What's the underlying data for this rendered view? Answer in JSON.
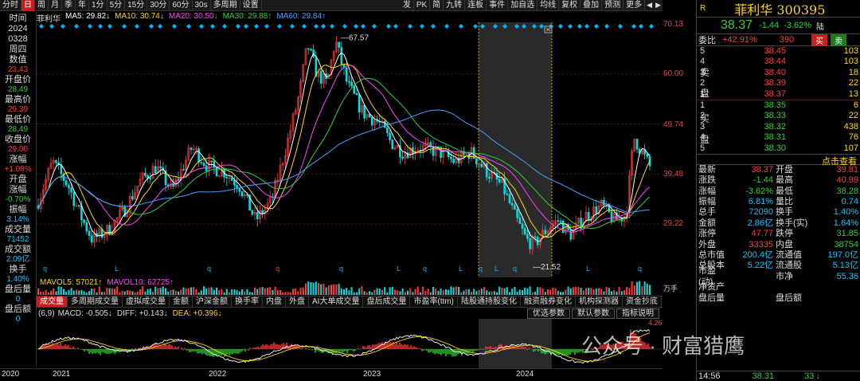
{
  "toolbar": {
    "left_items": [
      "分时",
      "日",
      "周",
      "月",
      "季",
      "年",
      "1分",
      "5分",
      "15分",
      "30分",
      "60分",
      "30s",
      "多周期",
      "设置"
    ],
    "active_index": 1,
    "right_items": [
      "发",
      "PK",
      "简",
      "九转",
      "连板",
      "事件",
      "加自选",
      "均线",
      "复权",
      "叠加",
      "预测",
      "更多"
    ]
  },
  "ma": {
    "name": "菲利华",
    "ma5": "MA5: 29.82↓",
    "ma10": "MA10: 30.74↓",
    "ma20": "MA20: 30.50↓",
    "ma30": "MA30: 29.88↑",
    "ma60": "MA60: 29.84↑",
    "colors": {
      "name": "#ddd",
      "ma5": "#ffffff",
      "ma10": "#ffd700",
      "ma20": "#ff40ff",
      "ma30": "#2fd02f",
      "ma60": "#4a9eff"
    }
  },
  "left_panel": [
    {
      "label": "时间",
      "value": "",
      "cls": ""
    },
    {
      "label": "2024",
      "value": "",
      "cls": ""
    },
    {
      "label": "0328",
      "value": "",
      "cls": ""
    },
    {
      "label": "周四",
      "value": "",
      "cls": ""
    },
    {
      "label": "数值",
      "value": "23.43",
      "cls": "red"
    },
    {
      "label": "开盘价",
      "value": "28.49",
      "cls": "green"
    },
    {
      "label": "最高价",
      "value": "29.39",
      "cls": "red"
    },
    {
      "label": "最低价",
      "value": "28.49",
      "cls": "green"
    },
    {
      "label": "收盘价",
      "value": "29.00",
      "cls": "red"
    },
    {
      "label": "涨幅",
      "value": "+1.08%",
      "cls": "red"
    },
    {
      "label": "开盘",
      "value": "",
      "cls": ""
    },
    {
      "label": "涨幅",
      "value": "-0.70%",
      "cls": "green"
    },
    {
      "label": "振幅",
      "value": "3.14%",
      "cls": "cyan"
    },
    {
      "label": "成交量",
      "value": "71452",
      "cls": "cyan"
    },
    {
      "label": "成交额",
      "value": "2.09亿",
      "cls": "cyan"
    },
    {
      "label": "换手",
      "value": "1.40%",
      "cls": "cyan"
    },
    {
      "label": "盘后量",
      "value": "0",
      "cls": "cyan"
    },
    {
      "label": "盘后额",
      "value": "0",
      "cls": "cyan"
    }
  ],
  "price_axis": [
    "70.13",
    "60.00",
    "49.74",
    "39.48",
    "29.22"
  ],
  "chart_annotations": {
    "high": "67.57",
    "low": "21.52"
  },
  "volume": {
    "mavol5": "MAVOL5: 57021↑",
    "mavol10": "MAVOL10: 62725↑",
    "scale": "万手"
  },
  "indicator_tabs": [
    "成交量",
    "多周期成交量",
    "虚拟成交量",
    "金额",
    "沪深金额",
    "换手率",
    "内盘",
    "外盘",
    "AI大单成交量",
    "盘后成交量",
    "市盈率(ttm)",
    "陆股通持股变化",
    "融资融券变化",
    "机构探测器",
    "资金抄底"
  ],
  "indicator_active": 0,
  "macd": {
    "params": "(6,9)",
    "macd": "MACD: -0.505↓",
    "diff": "DIFF: +0.143↓",
    "dea": "DEA: +0.396↓",
    "buttons": [
      "优选参数",
      "默认参数",
      "指标说明"
    ],
    "scale_hi": "4.26"
  },
  "years": [
    "2020",
    "2021",
    "2022",
    "2023",
    "2024"
  ],
  "quote": {
    "title": "菲利华 300395",
    "price": "38.37",
    "change": "-1.44",
    "pct": "-3.62%",
    "tag": "陆",
    "weibi_label": "委比",
    "weibi": "+42.91%",
    "weicha": "390",
    "buy_btn": "买",
    "sell_btn": "卖"
  },
  "sell_orders": [
    {
      "lvl": "5",
      "price": "38.45",
      "vol": "103"
    },
    {
      "lvl": "4",
      "price": "38.44",
      "vol": "103"
    },
    {
      "lvl": "3",
      "price": "38.40",
      "vol": "18"
    },
    {
      "lvl": "2",
      "price": "38.39",
      "vol": "22"
    },
    {
      "lvl": "1",
      "price": "38.37",
      "vol": "13"
    }
  ],
  "buy_orders": [
    {
      "lvl": "1",
      "price": "38.35",
      "vol": "6"
    },
    {
      "lvl": "2",
      "price": "38.33",
      "vol": "22"
    },
    {
      "lvl": "3",
      "price": "38.32",
      "vol": "438"
    },
    {
      "lvl": "4",
      "price": "38.31",
      "vol": "76"
    },
    {
      "lvl": "5",
      "price": "38.30",
      "vol": "107"
    }
  ],
  "sell_side_label": [
    "卖",
    "盘"
  ],
  "buy_side_label": [
    "买",
    "盘"
  ],
  "buy_sell_link": "点击查看",
  "stats": [
    [
      "最新",
      "38.37",
      "red",
      "开盘",
      "39.81",
      "red"
    ],
    [
      "涨跌",
      "-1.44",
      "green",
      "最高",
      "40.99",
      "red"
    ],
    [
      "涨幅",
      "-3.62%",
      "green",
      "最低",
      "38.28",
      "green"
    ],
    [
      "振幅",
      "6.81%",
      "cyan",
      "量比",
      "0.74",
      "cyan"
    ],
    [
      "总手",
      "72090",
      "cyan",
      "换手",
      "1.40%",
      "cyan"
    ],
    [
      "金额",
      "2.86亿",
      "cyan",
      "换手(实)",
      "1.64%",
      "cyan"
    ],
    [
      "涨停",
      "47.77",
      "red",
      "跌停",
      "31.85",
      "green"
    ],
    [
      "外盘",
      "33335",
      "red",
      "内盘",
      "38754",
      "green"
    ],
    [
      "总市值",
      "200.4亿",
      "cyan",
      "流通值",
      "197.0亿",
      "cyan"
    ],
    [
      "总股本",
      "5.22亿",
      "cyan",
      "流通股",
      "5.13亿",
      "cyan"
    ],
    [
      "市盈(动)",
      "",
      "cyan",
      "市净",
      "55.36",
      "cyan"
    ],
    [
      "净资产",
      "",
      "cyan",
      "",
      "",
      "cyan"
    ],
    [
      "盘后量",
      "",
      "cyan",
      "盘后额",
      "",
      "cyan"
    ]
  ],
  "last_trade": {
    "time": "14:56",
    "price": "38.31",
    "vol": "33",
    "flag": "↓"
  },
  "watermark": "公众号 · 财富猎鹰"
}
